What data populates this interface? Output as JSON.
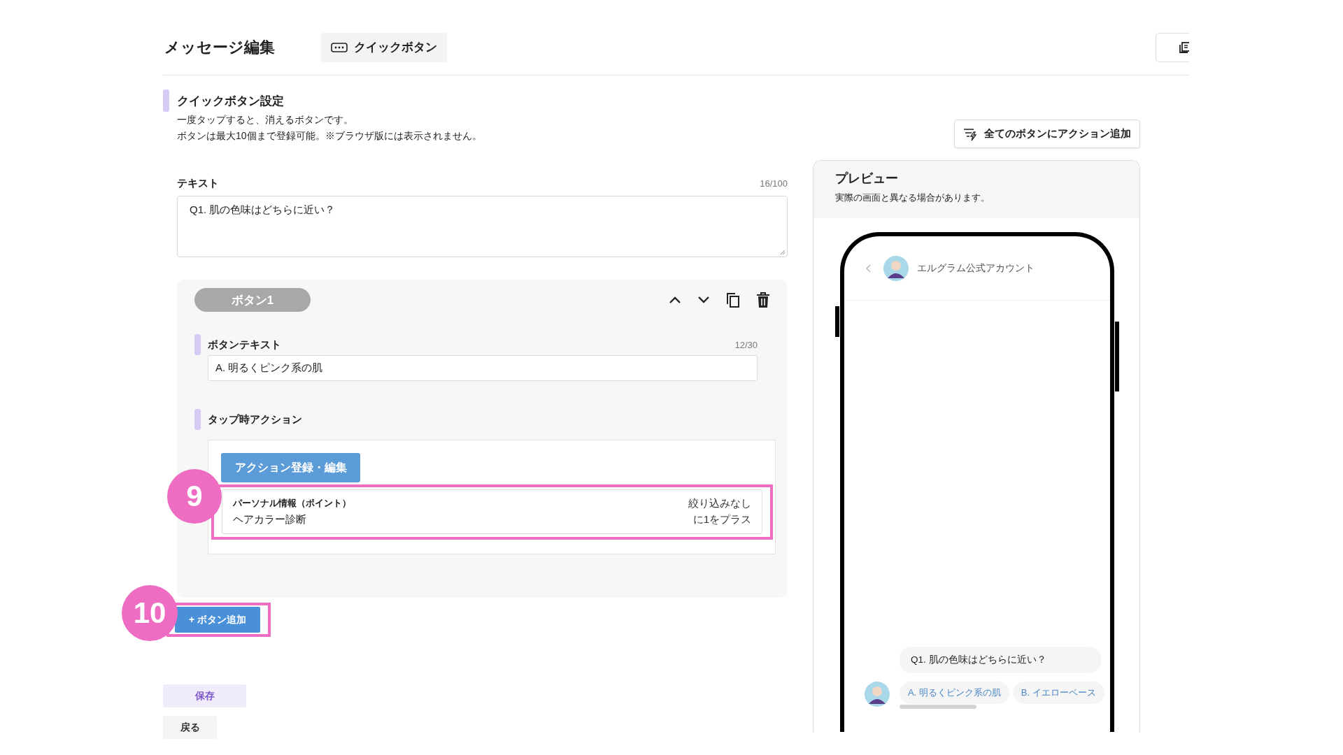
{
  "header": {
    "title": "メッセージ編集",
    "tab": "クイックボタン"
  },
  "section": {
    "title": "クイックボタン設定",
    "description": [
      "一度タップすると、消えるボタンです。",
      "ボタンは最大10個まで登録可能。※ブラウザ版には表示されません。"
    ],
    "add_all_button": "全てのボタンにアクション追加"
  },
  "text_field": {
    "label": "テキスト",
    "count": "16/100",
    "value": "Q1. 肌の色味はどちらに近い？"
  },
  "buttons": [
    {
      "badge": "ボタン1",
      "text_label": "ボタンテキスト",
      "text_count": "12/30",
      "text_value": "A. 明るくピンク系の肌",
      "action_label": "タップ時アクション",
      "action_button": "アクション登録・編集",
      "actions": [
        {
          "title": "パーソナル情報（ポイント）",
          "name": "ヘアカラー診断",
          "condition": "絞り込みなし",
          "effect": "に1をプラス",
          "annotation": "9"
        }
      ]
    }
  ],
  "add_button": {
    "label": "+ ボタン追加",
    "annotation": "10"
  },
  "save_button": "保存",
  "back_button": "戻る",
  "preview": {
    "title": "プレビュー",
    "note": "実際の画面と異なる場合があります。",
    "account": "エルグラム公式アカウント",
    "message": "Q1. 肌の色味はどちらに近い？",
    "quick_replies": [
      "A. 明るくピンク系の肌",
      "B. イエローベース"
    ]
  }
}
